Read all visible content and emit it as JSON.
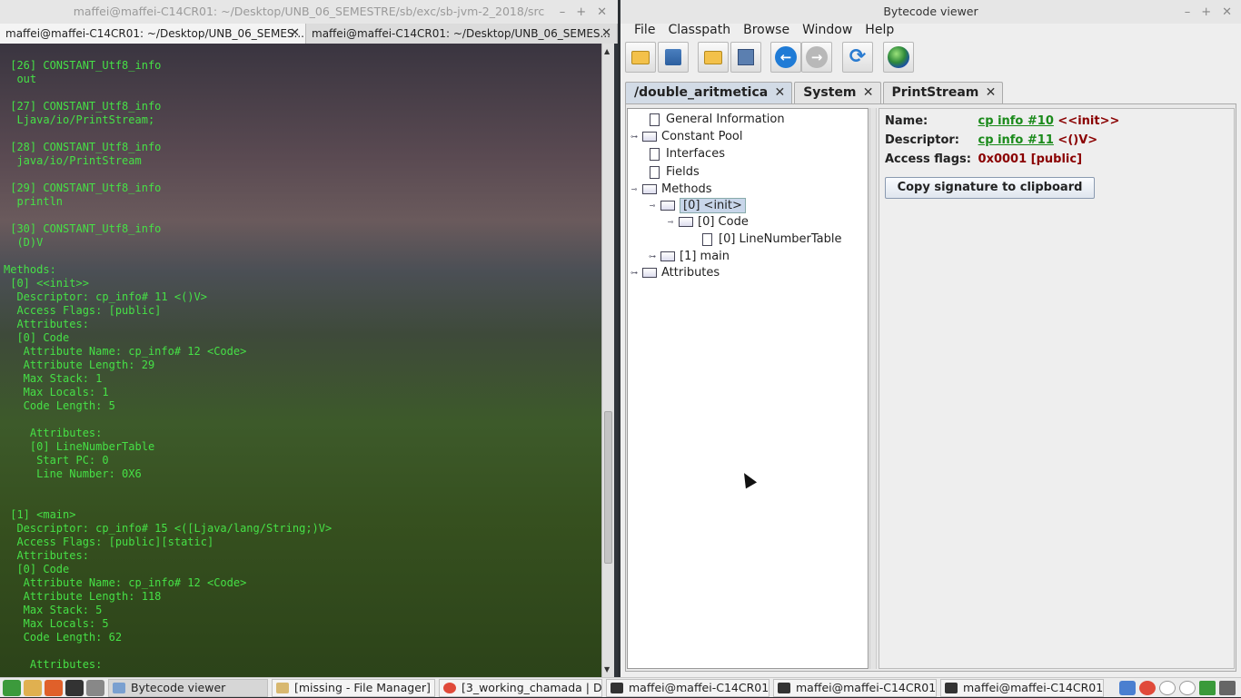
{
  "terminal": {
    "window_title": "maffei@maffei-C14CR01: ~/Desktop/UNB_06_SEMESTRE/sb/exc/sb-jvm-2_2018/src",
    "tabs": [
      {
        "label": "maffei@maffei-C14CR01: ~/Desktop/UNB_06_SEMES..."
      },
      {
        "label": "maffei@maffei-C14CR01: ~/Desktop/UNB_06_SEMES..."
      }
    ],
    "output": " [26] CONSTANT_Utf8_info\n  out\n\n [27] CONSTANT_Utf8_info\n  Ljava/io/PrintStream;\n\n [28] CONSTANT_Utf8_info\n  java/io/PrintStream\n\n [29] CONSTANT_Utf8_info\n  println\n\n [30] CONSTANT_Utf8_info\n  (D)V\n\nMethods:\n [0] <<init>>\n  Descriptor: cp_info# 11 <()V>\n  Access Flags: [public]\n  Attributes:\n  [0] Code\n   Attribute Name: cp_info# 12 <Code>\n   Attribute Length: 29\n   Max Stack: 1\n   Max Locals: 1\n   Code Length: 5\n\n    Attributes:\n    [0] LineNumberTable\n     Start PC: 0\n     Line Number: 0X6\n\n\n [1] <main>\n  Descriptor: cp_info# 15 <([Ljava/lang/String;)V>\n  Access Flags: [public][static]\n  Attributes:\n  [0] Code\n   Attribute Name: cp_info# 12 <Code>\n   Attribute Length: 118\n   Max Stack: 5\n   Max Locals: 5\n   Code Length: 62\n\n    Attributes:"
  },
  "viewer": {
    "window_title": "Bytecode viewer",
    "menu": [
      "File",
      "Classpath",
      "Browse",
      "Window",
      "Help"
    ],
    "tabs": [
      {
        "label": "/double_aritmetica"
      },
      {
        "label": "System"
      },
      {
        "label": "PrintStream"
      }
    ],
    "tree": {
      "general_information": "General Information",
      "constant_pool": "Constant Pool",
      "interfaces": "Interfaces",
      "fields": "Fields",
      "methods": "Methods",
      "init": "[0] <init>",
      "code": "[0] Code",
      "line_number_table": "[0] LineNumberTable",
      "main": "[1] main",
      "attributes": "Attributes"
    },
    "detail": {
      "name_label": "Name:",
      "name_link": "cp info #10",
      "name_value": "<<init>>",
      "descriptor_label": "Descriptor:",
      "descriptor_link": "cp info #11",
      "descriptor_value": "<()V>",
      "access_label": "Access flags:",
      "access_value": "0x0001 [public]",
      "copy_button": "Copy signature to clipboard"
    }
  },
  "taskbar": {
    "tasks": [
      {
        "label": "Bytecode viewer"
      },
      {
        "label": "[missing - File Manager]"
      },
      {
        "label": "[3_working_chamada | Di..."
      },
      {
        "label": "maffei@maffei-C14CR01: ..."
      },
      {
        "label": "maffei@maffei-C14CR01: ..."
      },
      {
        "label": "maffei@maffei-C14CR01: ..."
      }
    ]
  },
  "colors": {
    "terminal_text": "#46e046",
    "link": "#1a8a1a",
    "value": "#8a0000"
  }
}
